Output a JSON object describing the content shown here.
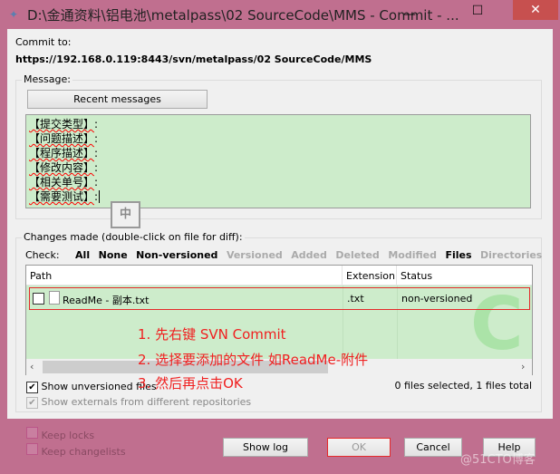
{
  "window": {
    "title": "D:\\金通资料\\铝电池\\metalpass\\02 SourceCode\\MMS - Commit - ...",
    "minimize": "—",
    "maximize": "☐",
    "close": "✕"
  },
  "commit_to": {
    "label": "Commit to:",
    "url": "https://192.168.0.119:8443/svn/metalpass/02 SourceCode/MMS"
  },
  "message": {
    "group_label": "Message:",
    "recent_button": "Recent messages",
    "lines": [
      {
        "field": "【提交类型】",
        "sep": ":"
      },
      {
        "field": "【问题描述】",
        "sep": ":"
      },
      {
        "field": "【程序描述】",
        "sep": ":"
      },
      {
        "field": "【修改内容】",
        "sep": ":"
      },
      {
        "field": "【相关单号】",
        "sep": ":"
      },
      {
        "field": "【需要测试】",
        "sep": ":"
      }
    ],
    "ime_indicator": "中"
  },
  "changes": {
    "group_label": "Changes made (double-click on file for diff):",
    "check_label": "Check:",
    "filters": [
      {
        "label": "All",
        "enabled": true
      },
      {
        "label": "None",
        "enabled": true
      },
      {
        "label": "Non-versioned",
        "enabled": true
      },
      {
        "label": "Versioned",
        "enabled": false
      },
      {
        "label": "Added",
        "enabled": false
      },
      {
        "label": "Deleted",
        "enabled": false
      },
      {
        "label": "Modified",
        "enabled": false
      },
      {
        "label": "Files",
        "enabled": true
      },
      {
        "label": "Directories",
        "enabled": false
      }
    ],
    "columns": [
      "Path",
      "Extension",
      "Status"
    ],
    "rows": [
      {
        "checked": false,
        "path": "ReadMe - 副本.txt",
        "extension": ".txt",
        "status": "non-versioned"
      }
    ],
    "show_unversioned": {
      "label": "Show unversioned files",
      "checked": true
    },
    "show_externals": {
      "label": "Show externals from different repositories",
      "checked": true,
      "enabled": false
    },
    "summary": "0 files selected, 1 files total"
  },
  "annotations": [
    "1. 先右键 SVN Commit",
    "2. 选择要添加的文件 如ReadMe-附件",
    "3. 然后再点击OK"
  ],
  "bottom": {
    "keep_locks": "Keep locks",
    "keep_changelists": "Keep changelists",
    "show_log": "Show log",
    "ok": "OK",
    "cancel": "Cancel",
    "help": "Help"
  },
  "watermark": "@51CTO博客",
  "colors": {
    "frame": "#c06f8f",
    "message_bg": "#cdeccb",
    "highlight": "#e52a2a",
    "annotation": "#f02020"
  }
}
